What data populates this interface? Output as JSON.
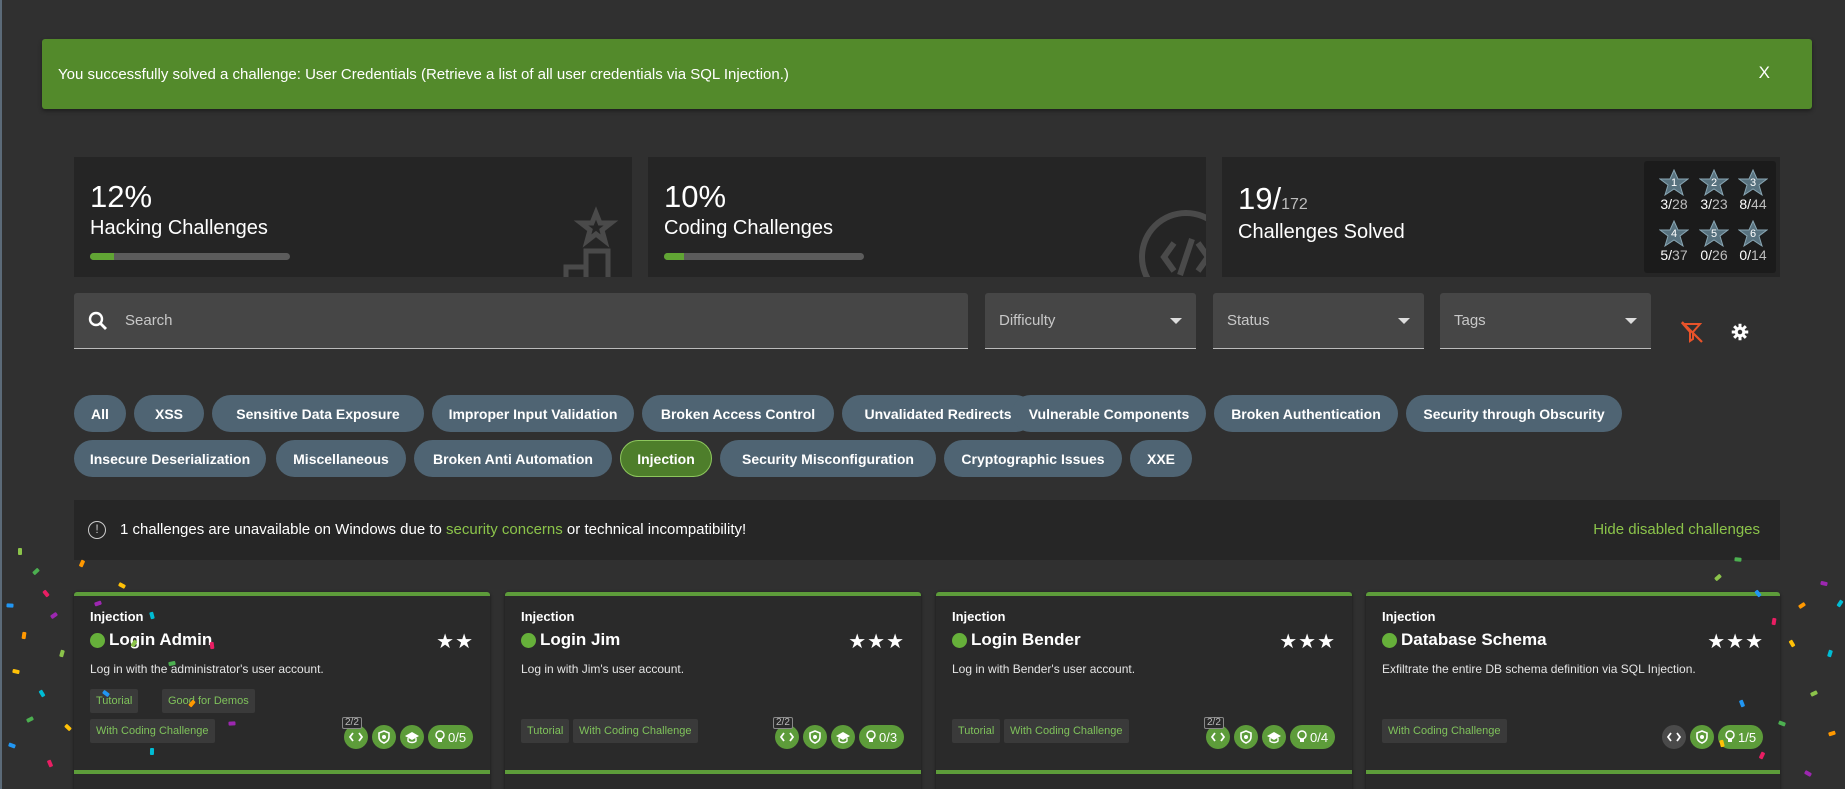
{
  "notification": {
    "message": "You successfully solved a challenge: User Credentials (Retrieve a list of all user credentials via SQL Injection.)",
    "close_label": "X"
  },
  "stats": {
    "hacking": {
      "percent": "12%",
      "label": "Hacking Challenges",
      "progress": 0.12
    },
    "coding": {
      "percent": "10%",
      "label": "Coding Challenges",
      "progress": 0.1
    },
    "solved": {
      "count": "19/",
      "total": "172",
      "label": "Challenges Solved",
      "difficulties": [
        {
          "level": "1",
          "solved": "3/",
          "total": "28"
        },
        {
          "level": "2",
          "solved": "3/",
          "total": "23"
        },
        {
          "level": "3",
          "solved": "8/",
          "total": "44"
        },
        {
          "level": "4",
          "solved": "5/",
          "total": "37"
        },
        {
          "level": "5",
          "solved": "0/",
          "total": "26"
        },
        {
          "level": "6",
          "solved": "0/",
          "total": "14"
        }
      ]
    }
  },
  "filters": {
    "search_placeholder": "Search",
    "difficulty": "Difficulty",
    "status": "Status",
    "tags": "Tags"
  },
  "categories": [
    "All",
    "XSS",
    "Sensitive Data Exposure",
    "Improper Input Validation",
    "Broken Access Control",
    "Unvalidated Redirects",
    "Vulnerable Components",
    "Broken Authentication",
    "Security through Obscurity",
    "Insecure Deserialization",
    "Miscellaneous",
    "Broken Anti Automation",
    "Injection",
    "Security Misconfiguration",
    "Cryptographic Issues",
    "XXE"
  ],
  "active_category": "Injection",
  "notice": {
    "info_icon": "!",
    "text_before": "1 challenges are unavailable on Windows due to ",
    "link": "security concerns",
    "text_after": " or technical incompatibility!",
    "hide_label": "Hide disabled challenges"
  },
  "challenges": [
    {
      "category": "Injection",
      "title": "Login Admin",
      "stars": "★★",
      "description": "Log in with the administrator's user account.",
      "tags": [
        "Tutorial",
        "Good for Demos",
        "With Coding Challenge"
      ],
      "coding_progress": "2/2",
      "hints": "0/5"
    },
    {
      "category": "Injection",
      "title": "Login Jim",
      "stars": "★★★",
      "description": "Log in with Jim's user account.",
      "tags": [
        "Tutorial",
        "With Coding Challenge"
      ],
      "coding_progress": "2/2",
      "hints": "0/3"
    },
    {
      "category": "Injection",
      "title": "Login Bender",
      "stars": "★★★",
      "description": "Log in with Bender's user account.",
      "tags": [
        "Tutorial",
        "With Coding Challenge"
      ],
      "coding_progress": "2/2",
      "hints": "0/4"
    },
    {
      "category": "Injection",
      "title": "Database Schema",
      "stars": "★★★",
      "description": "Exfiltrate the entire DB schema definition via SQL Injection.",
      "tags": [
        "With Coding Challenge"
      ],
      "hints": "1/5"
    }
  ],
  "colors": {
    "accent": "#5d9c3a",
    "chip": "#4f6473",
    "snack": "#538a2b",
    "filter_clear": "#e8532a"
  }
}
